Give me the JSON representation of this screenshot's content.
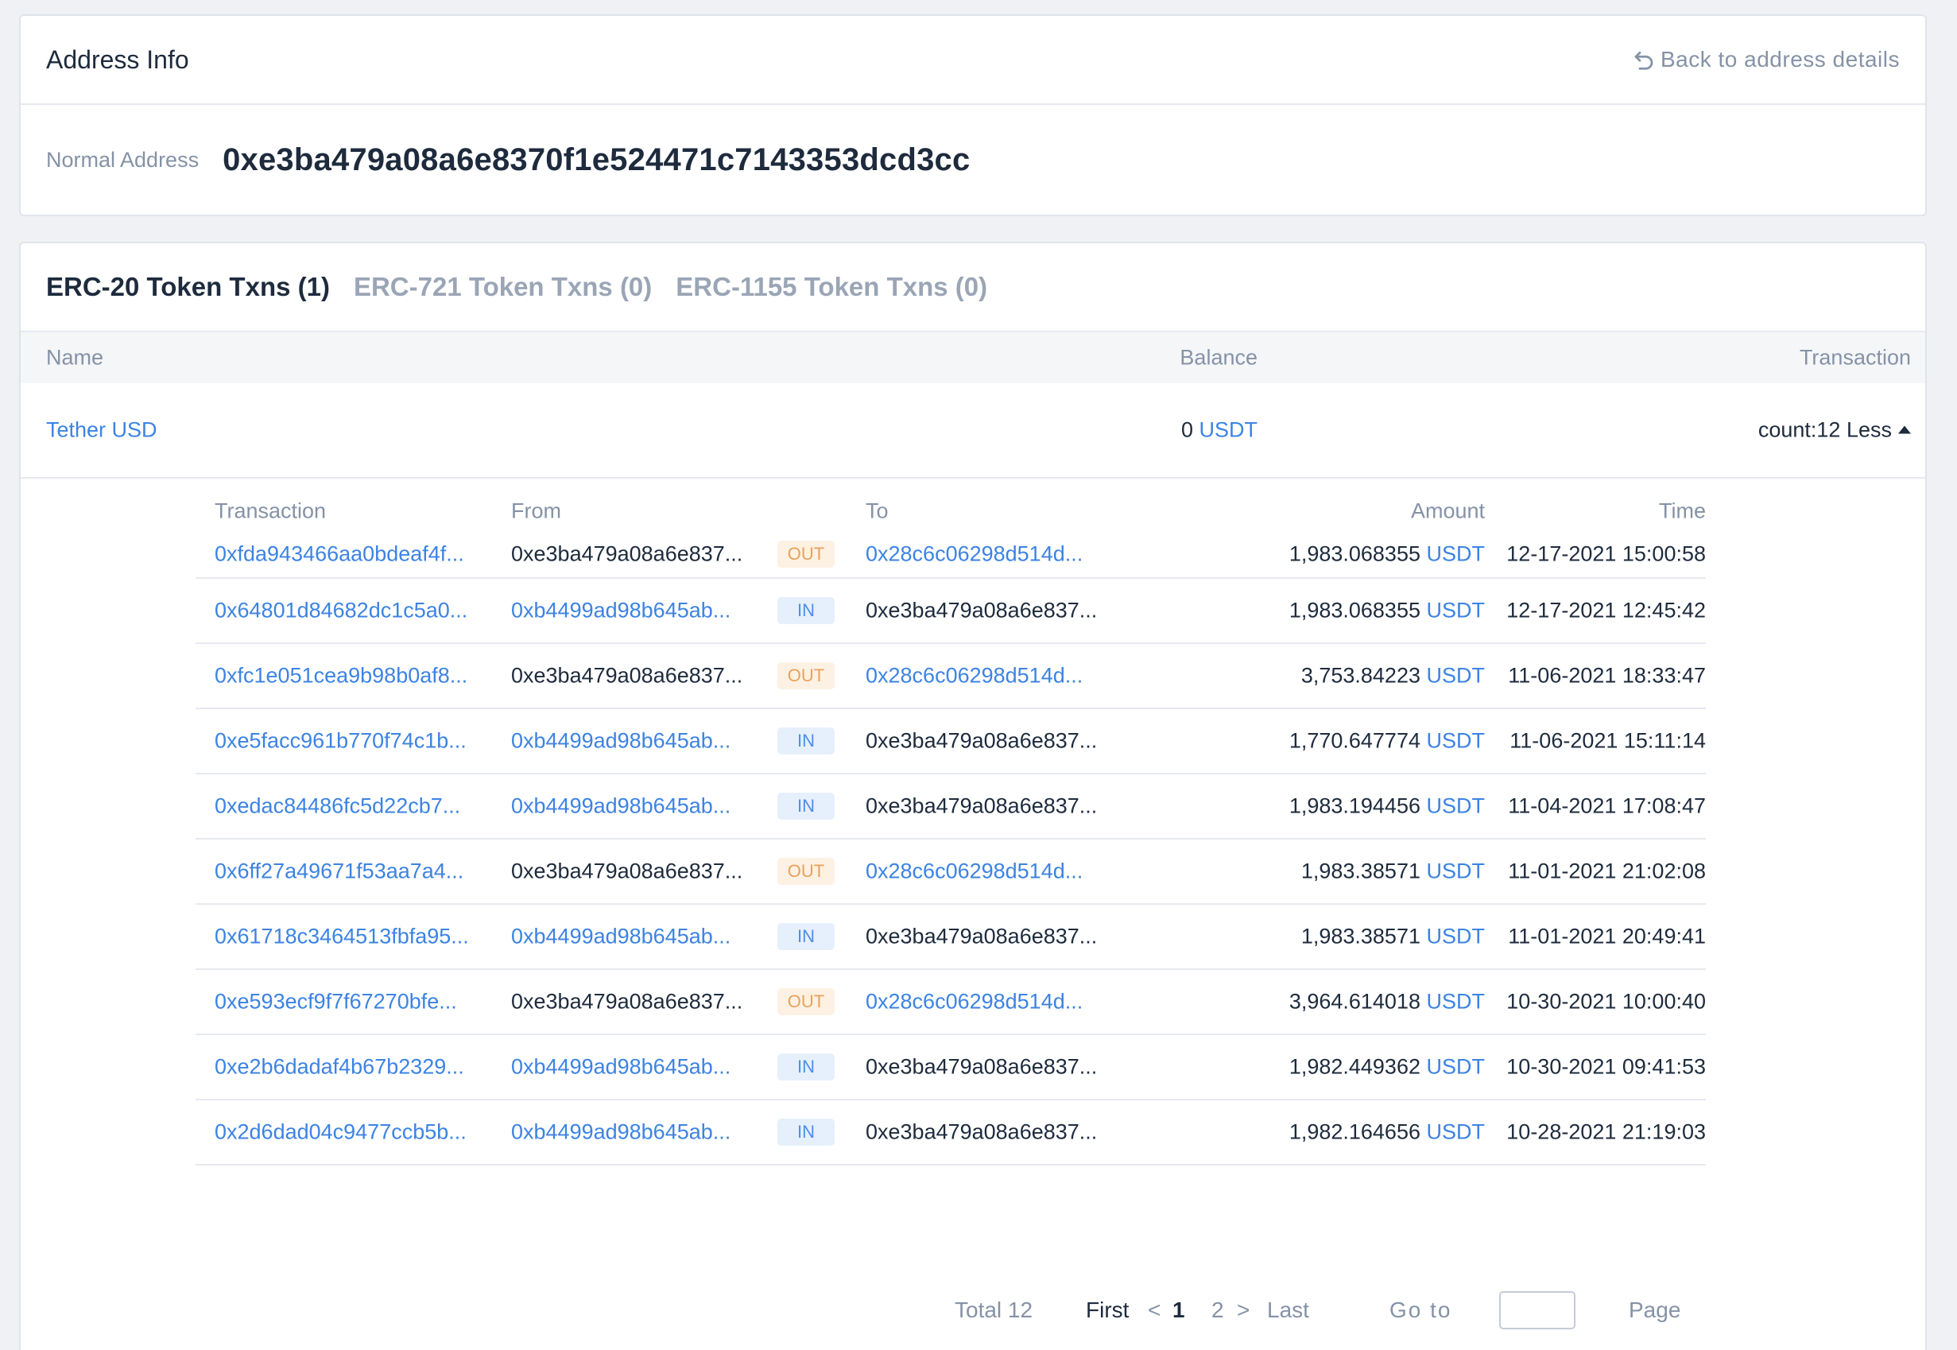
{
  "address_info": {
    "title": "Address Info",
    "back_label": "Back to address details",
    "address_label": "Normal Address",
    "address": "0xe3ba479a08a6e8370f1e524471c7143353dcd3cc"
  },
  "tabs": [
    {
      "label": "ERC-20 Token Txns (1)",
      "active": true
    },
    {
      "label": "ERC-721 Token Txns (0)",
      "active": false
    },
    {
      "label": "ERC-1155 Token Txns (0)",
      "active": false
    }
  ],
  "token_table": {
    "headers": {
      "name": "Name",
      "balance": "Balance",
      "transaction": "Transaction"
    },
    "row": {
      "name": "Tether USD",
      "balance_value": "0",
      "balance_unit": "USDT",
      "count": "count:12",
      "toggle": "Less"
    }
  },
  "txn_table": {
    "headers": {
      "transaction": "Transaction",
      "from": "From",
      "to": "To",
      "amount": "Amount",
      "time": "Time"
    },
    "rows": [
      {
        "txn": "0xfda943466aa0bdeaf4f...",
        "from": "0xe3ba479a08a6e837...",
        "dir": "OUT",
        "to": "0x28c6c06298d514d...",
        "amount": "1,983.068355",
        "unit": "USDT",
        "time": "12-17-2021 15:00:58"
      },
      {
        "txn": "0x64801d84682dc1c5a0...",
        "from": "0xb4499ad98b645ab...",
        "dir": "IN",
        "to": "0xe3ba479a08a6e837...",
        "amount": "1,983.068355",
        "unit": "USDT",
        "time": "12-17-2021 12:45:42"
      },
      {
        "txn": "0xfc1e051cea9b98b0af8...",
        "from": "0xe3ba479a08a6e837...",
        "dir": "OUT",
        "to": "0x28c6c06298d514d...",
        "amount": "3,753.84223",
        "unit": "USDT",
        "time": "11-06-2021 18:33:47"
      },
      {
        "txn": "0xe5facc961b770f74c1b...",
        "from": "0xb4499ad98b645ab...",
        "dir": "IN",
        "to": "0xe3ba479a08a6e837...",
        "amount": "1,770.647774",
        "unit": "USDT",
        "time": "11-06-2021 15:11:14"
      },
      {
        "txn": "0xedac84486fc5d22cb7...",
        "from": "0xb4499ad98b645ab...",
        "dir": "IN",
        "to": "0xe3ba479a08a6e837...",
        "amount": "1,983.194456",
        "unit": "USDT",
        "time": "11-04-2021 17:08:47"
      },
      {
        "txn": "0x6ff27a49671f53aa7a4...",
        "from": "0xe3ba479a08a6e837...",
        "dir": "OUT",
        "to": "0x28c6c06298d514d...",
        "amount": "1,983.38571",
        "unit": "USDT",
        "time": "11-01-2021 21:02:08"
      },
      {
        "txn": "0x61718c3464513fbfa95...",
        "from": "0xb4499ad98b645ab...",
        "dir": "IN",
        "to": "0xe3ba479a08a6e837...",
        "amount": "1,983.38571",
        "unit": "USDT",
        "time": "11-01-2021 20:49:41"
      },
      {
        "txn": "0xe593ecf9f7f67270bfe...",
        "from": "0xe3ba479a08a6e837...",
        "dir": "OUT",
        "to": "0x28c6c06298d514d...",
        "amount": "3,964.614018",
        "unit": "USDT",
        "time": "10-30-2021 10:00:40"
      },
      {
        "txn": "0xe2b6dadaf4b67b2329...",
        "from": "0xb4499ad98b645ab...",
        "dir": "IN",
        "to": "0xe3ba479a08a6e837...",
        "amount": "1,982.449362",
        "unit": "USDT",
        "time": "10-30-2021 09:41:53"
      },
      {
        "txn": "0x2d6dad04c9477ccb5b...",
        "from": "0xb4499ad98b645ab...",
        "dir": "IN",
        "to": "0xe3ba479a08a6e837...",
        "amount": "1,982.164656",
        "unit": "USDT",
        "time": "10-28-2021 21:19:03"
      }
    ]
  },
  "pagination": {
    "total": "Total 12",
    "first": "First",
    "prev": "<",
    "current": "1",
    "next_page": "2",
    "next": ">",
    "last": "Last",
    "goto": "Go to",
    "input_value": "",
    "page": "Page"
  },
  "colors": {
    "link": "#3c83e3",
    "out_badge": "#e8a25b",
    "in_badge": "#4d8ee6"
  }
}
